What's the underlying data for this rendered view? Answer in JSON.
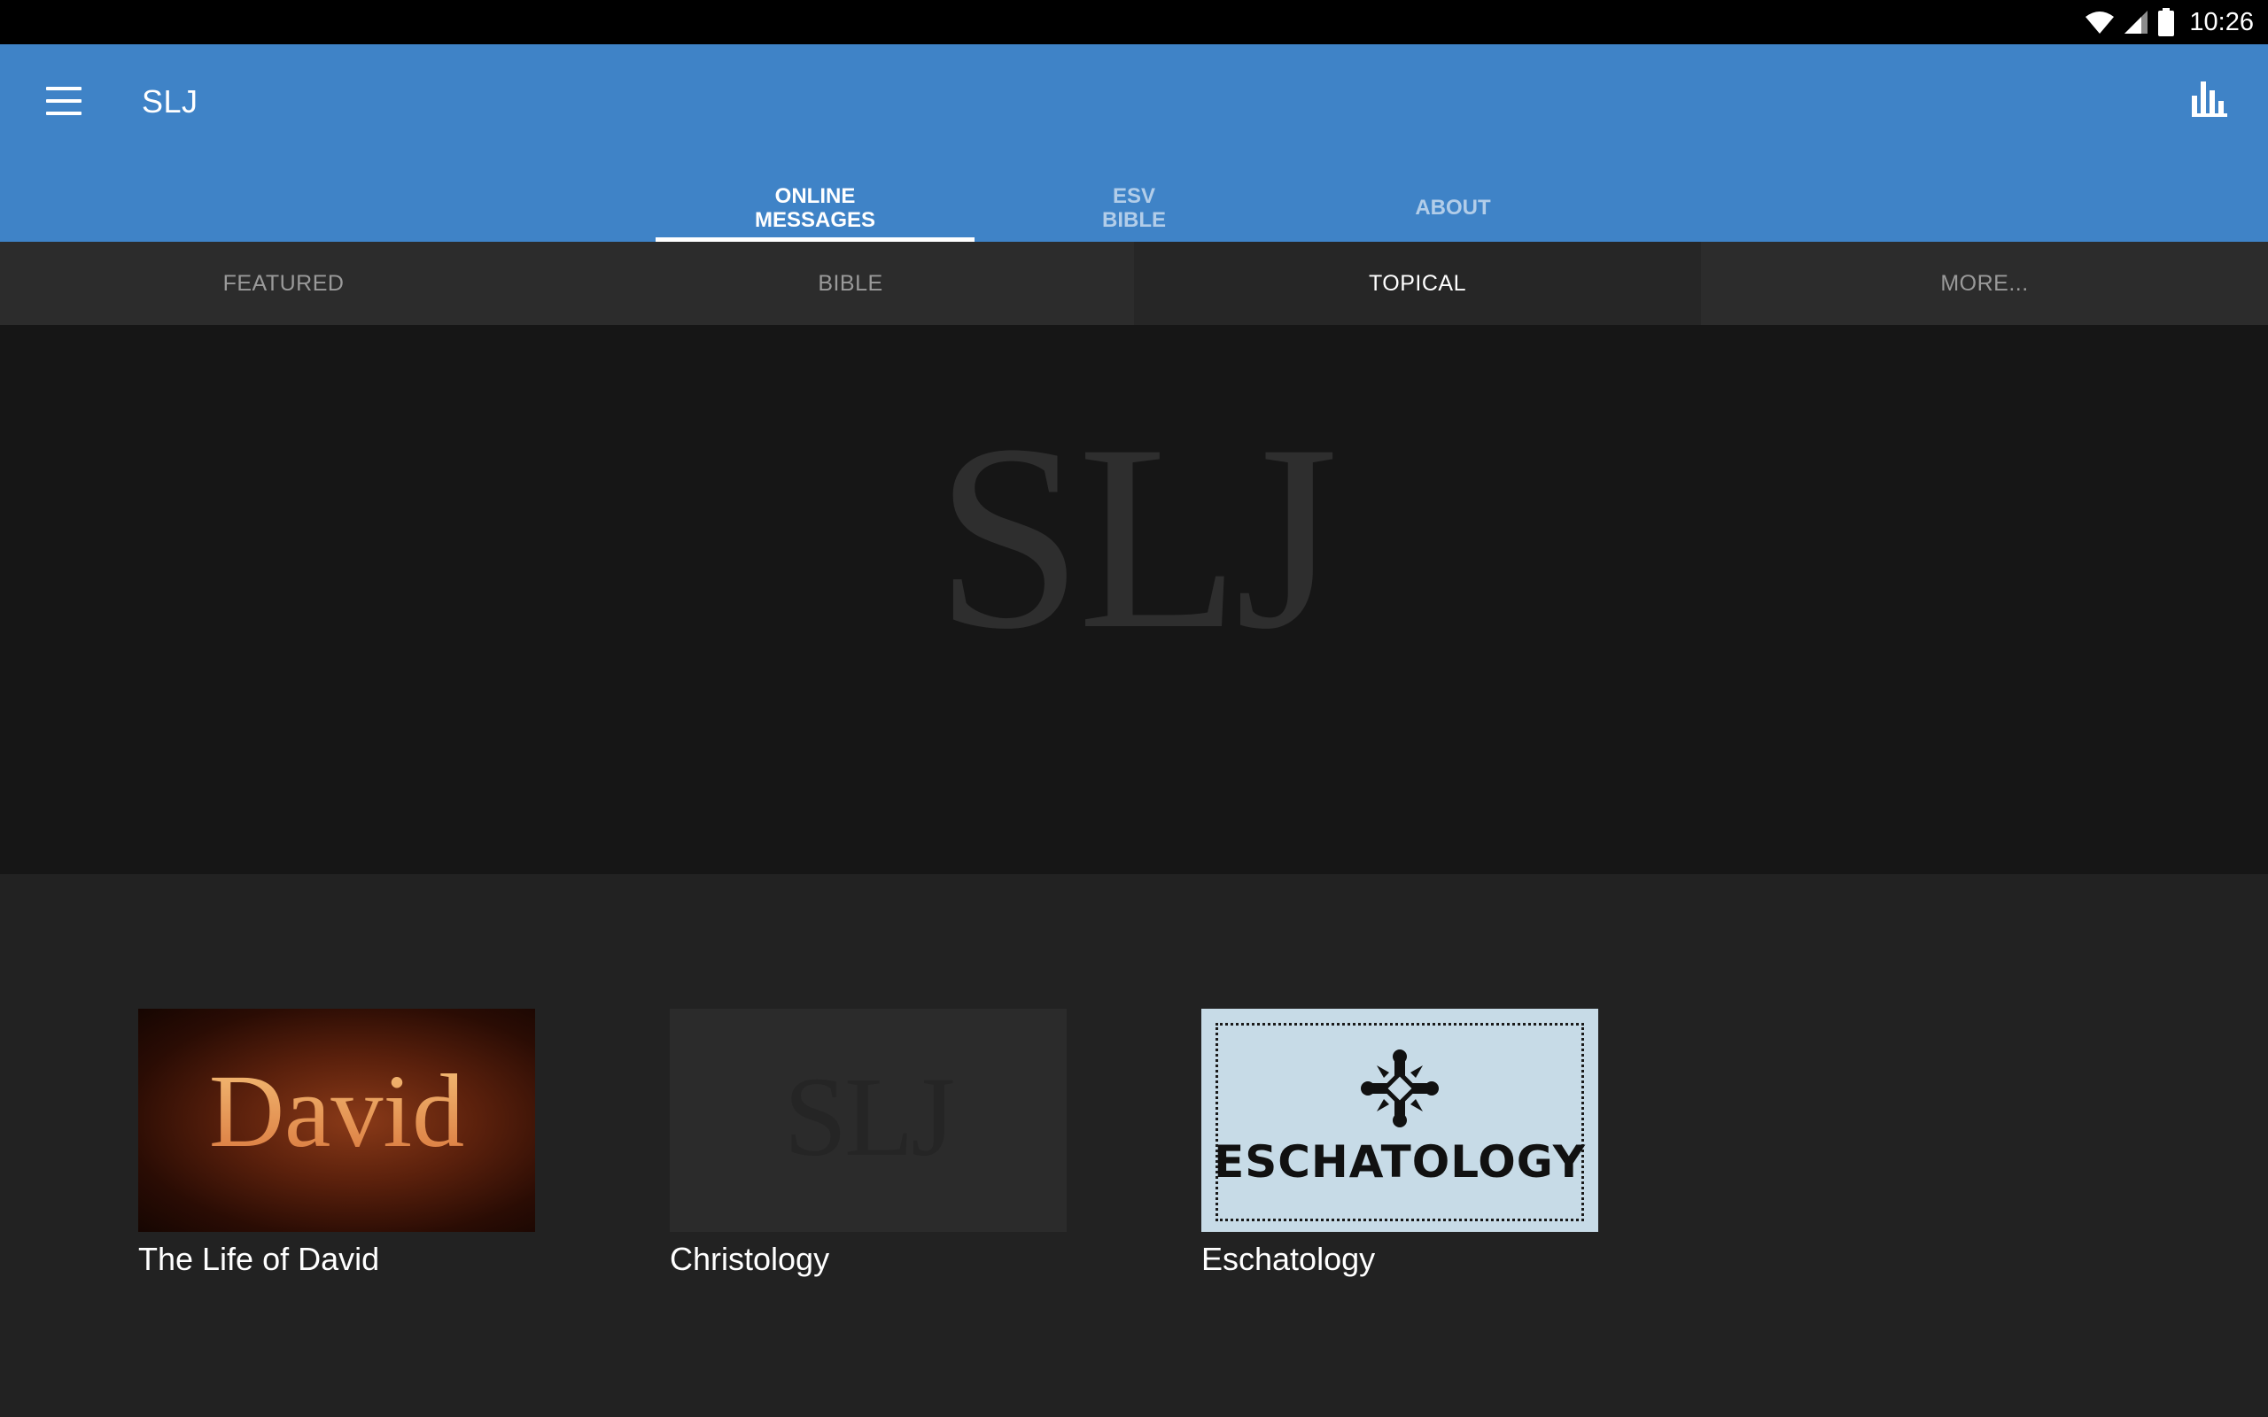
{
  "status_bar": {
    "time": "10:26",
    "icons": [
      "wifi-icon",
      "cell-signal-icon",
      "battery-icon"
    ]
  },
  "app_bar": {
    "title": "SLJ",
    "menu_icon": "menu-icon",
    "stats_icon": "bar-chart-icon",
    "color": "#3f83c7"
  },
  "main_tabs": [
    {
      "label": "ONLINE\nMESSAGES",
      "active": true
    },
    {
      "label": "ESV\nBIBLE",
      "active": false
    },
    {
      "label": "ABOUT",
      "active": false
    }
  ],
  "sub_tabs": [
    {
      "label": "FEATURED",
      "active": false
    },
    {
      "label": "BIBLE",
      "active": false
    },
    {
      "label": "TOPICAL",
      "active": true
    },
    {
      "label": "MORE...",
      "active": false
    }
  ],
  "hero": {
    "logo_text": "SLJ"
  },
  "cards": [
    {
      "title": "The Life of David",
      "thumb_text": "David",
      "thumb": "david"
    },
    {
      "title": "Christology",
      "thumb_text": "SLJ",
      "thumb": "slj"
    },
    {
      "title": "Eschatology",
      "thumb_text": "ESCHATOLOGY",
      "thumb": "eschatology"
    }
  ]
}
